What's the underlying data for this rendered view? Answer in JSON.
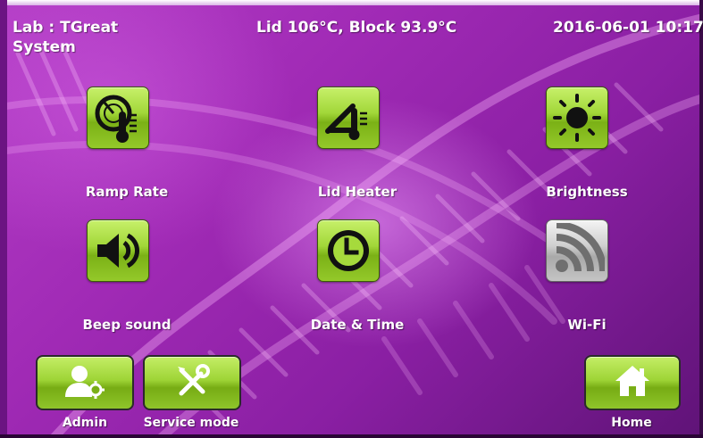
{
  "header": {
    "lab": "Lab : TGreat\nSystem",
    "status": "Lid 106°C, Block 93.9°C",
    "datetime": "2016-06-01 10:17"
  },
  "tiles": [
    {
      "label": "Ramp Rate",
      "icon": "ramp-rate-gauge-icon"
    },
    {
      "label": "Lid Heater",
      "icon": "lid-heater-icon"
    },
    {
      "label": "Brightness",
      "icon": "sun-icon"
    },
    {
      "label": "Beep sound",
      "icon": "speaker-icon"
    },
    {
      "label": "Date & Time",
      "icon": "clock-icon"
    },
    {
      "label": "Wi-Fi",
      "icon": "wifi-signal-icon"
    }
  ],
  "bottom": {
    "admin": "Admin",
    "service": "Service mode",
    "home": "Home"
  },
  "colors": {
    "background": "#a12cb0",
    "tile_green": "#9ed436",
    "tile_gray": "#bdbdbd",
    "text": "#ffffff"
  }
}
